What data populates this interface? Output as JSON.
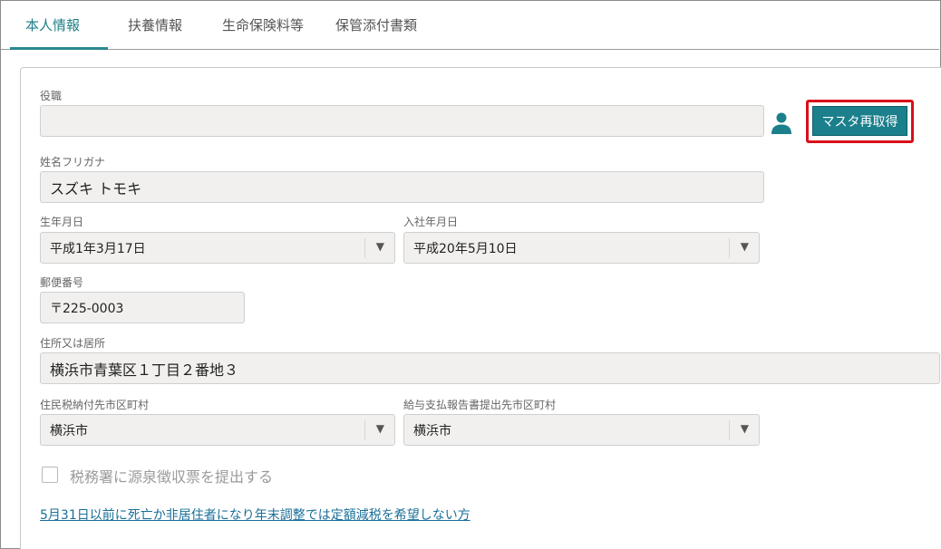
{
  "tabs": [
    {
      "label": "本人情報",
      "active": true
    },
    {
      "label": "扶養情報",
      "active": false
    },
    {
      "label": "生命保険料等",
      "active": false
    },
    {
      "label": "保管添付書類",
      "active": false
    }
  ],
  "form": {
    "position": {
      "label": "役職",
      "value": ""
    },
    "refetch_button": "マスタ再取得",
    "furigana": {
      "label": "姓名フリガナ",
      "value": "スズキ トモキ"
    },
    "birth_date": {
      "label": "生年月日",
      "value": "平成1年3月17日"
    },
    "hire_date": {
      "label": "入社年月日",
      "value": "平成20年5月10日"
    },
    "postal_code": {
      "label": "郵便番号",
      "value": "〒225-0003"
    },
    "address": {
      "label": "住所又は居所",
      "value": "横浜市青葉区１丁目２番地３"
    },
    "resident_tax_city": {
      "label": "住民税納付先市区町村",
      "value": "横浜市"
    },
    "salary_report_city": {
      "label": "給与支払報告書提出先市区町村",
      "value": "横浜市"
    },
    "tax_office_checkbox": {
      "label": "税務署に源泉徴収票を提出する",
      "checked": false
    },
    "death_link": "5月31日以前に死亡か非居住者になり年末調整では定額減税を希望しない方"
  },
  "colors": {
    "accent": "#1b7f8c",
    "highlight_border": "#d80f1a",
    "link": "#1a6f99"
  }
}
